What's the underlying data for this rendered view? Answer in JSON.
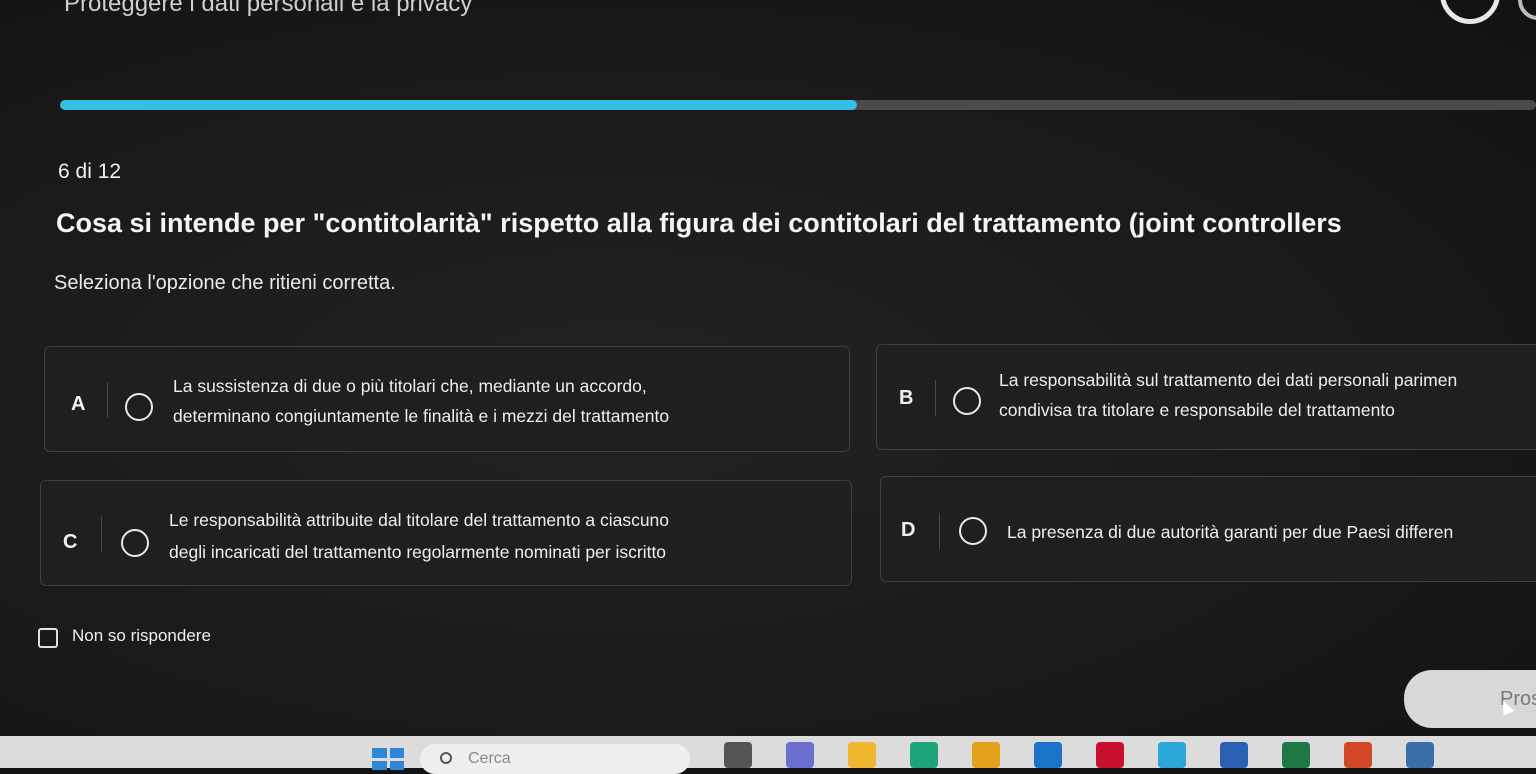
{
  "header": {
    "title": "Proteggere i dati personali e la privacy",
    "progress": 0.54
  },
  "quiz": {
    "counter": "6 di 12",
    "question": "Cosa si intende per \"contitolarità\" rispetto alla figura dei contitolari del trattamento (joint controllers",
    "instruction": "Seleziona l'opzione che ritieni corretta.",
    "options": [
      {
        "letter": "A",
        "line1": "La sussistenza di due o più titolari che, mediante un accordo,",
        "line2": "determinano congiuntamente le finalità e i mezzi del trattamento"
      },
      {
        "letter": "B",
        "line1": "La responsabilità sul trattamento dei dati personali parimen",
        "line2": "condivisa tra titolare e responsabile del trattamento"
      },
      {
        "letter": "C",
        "line1": "Le responsabilità attribuite dal titolare del trattamento a ciascuno",
        "line2": "degli incaricati del trattamento regolarmente nominati per iscritto"
      },
      {
        "letter": "D",
        "line1": "La presenza di due autorità garanti per due Paesi differen",
        "line2": ""
      }
    ],
    "dont_know_label": "Non so rispondere",
    "next_label": "Pros"
  },
  "taskbar": {
    "search_placeholder": "Cerca",
    "icons": [
      {
        "name": "task-view-icon",
        "color": "#555555"
      },
      {
        "name": "teams-icon",
        "color": "#6a6fd0"
      },
      {
        "name": "file-explorer-icon",
        "color": "#f2b730"
      },
      {
        "name": "edge-icon",
        "color": "#1fa37a"
      },
      {
        "name": "chrome-icon",
        "color": "#e3a21a"
      },
      {
        "name": "outlook-icon",
        "color": "#1a73c8"
      },
      {
        "name": "mcafee-icon",
        "color": "#c8102e"
      },
      {
        "name": "app-icon",
        "color": "#2aa7d8"
      },
      {
        "name": "word-icon",
        "color": "#2b5fb4"
      },
      {
        "name": "excel-icon",
        "color": "#1d7a45"
      },
      {
        "name": "powerpoint-icon",
        "color": "#d24726"
      },
      {
        "name": "calculator-icon",
        "color": "#3b6fa8"
      }
    ]
  }
}
